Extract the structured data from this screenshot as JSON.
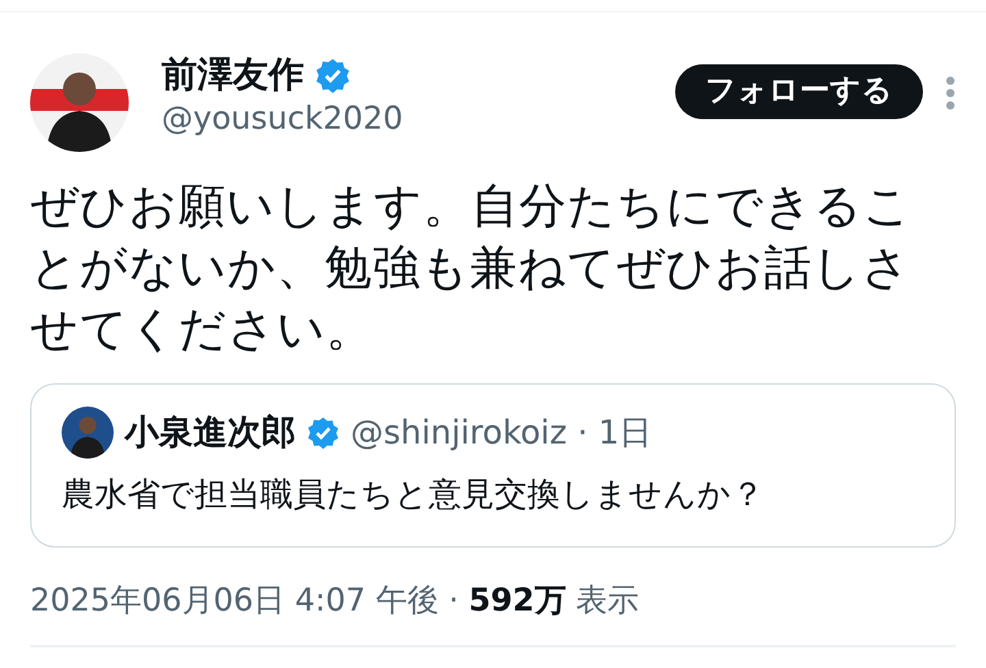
{
  "post": {
    "author": {
      "name": "前澤友作",
      "verified": true,
      "handle": "@yousuck2020"
    },
    "follow_button": "フォローする",
    "text": "ぜひお願いします。自分たちにできることがないか、勉強も兼ねてぜひお話しさせてください。",
    "quote": {
      "author": {
        "name": "小泉進次郎",
        "verified": true,
        "meta": "@shinjirokoiz · 1日"
      },
      "text": "農水省で担当職員たちと意見交換しませんか？"
    },
    "footer": "2025年06月06日 4:07 午後 · **592万** 表示"
  }
}
